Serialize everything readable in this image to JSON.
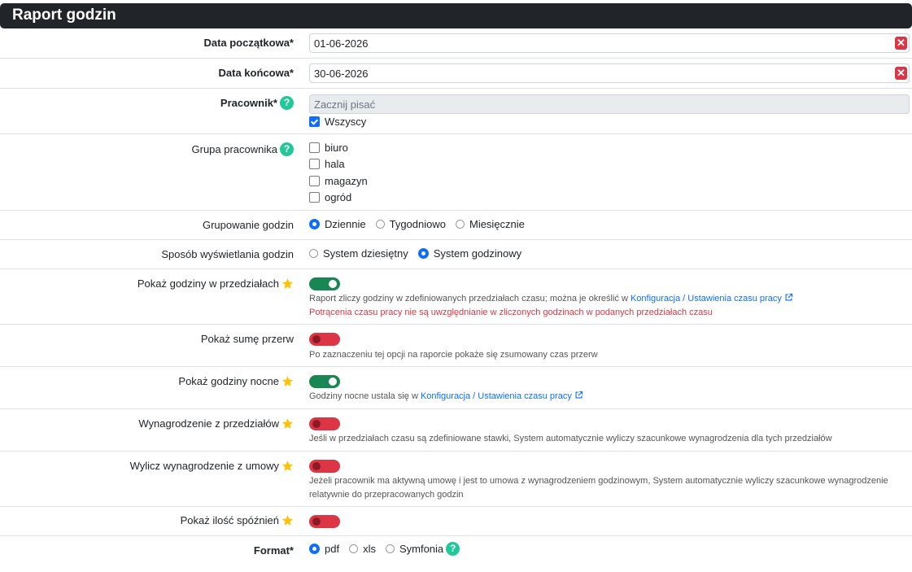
{
  "header": {
    "title": "Raport godzin"
  },
  "start_date": {
    "label": "Data początkowa*",
    "value": "01-06-2026"
  },
  "end_date": {
    "label": "Data końcowa*",
    "value": "30-06-2026"
  },
  "employee": {
    "label": "Pracownik*",
    "placeholder": "Zacznij pisać",
    "all_label": "Wszyscy",
    "all_checked": true
  },
  "group": {
    "label": "Grupa pracownika",
    "options": [
      "biuro",
      "hala",
      "magazyn",
      "ogród"
    ]
  },
  "grouping": {
    "label": "Grupowanie godzin",
    "options": [
      "Dziennie",
      "Tygodniowo",
      "Miesięcznie"
    ],
    "selected": "Dziennie"
  },
  "display": {
    "label": "Sposób wyświetlania godzin",
    "options": [
      "System dziesiętny",
      "System godzinowy"
    ],
    "selected": "System godzinowy"
  },
  "ranges": {
    "label": "Pokaż godziny w przedziałach",
    "enabled": true,
    "help_prefix": "Raport zliczy godziny w zdefiniowanych przedziałach czasu; można je określić w ",
    "help_link": "Konfiguracja / Ustawienia czasu pracy",
    "warning": "Potrącenia czasu pracy nie są uwzględnianie w zliczonych godzinach w podanych przedziałach czasu"
  },
  "breaks": {
    "label": "Pokaż sumę przerw",
    "enabled": false,
    "help": "Po zaznaczeniu tej opcji na raporcie pokaże się zsumowany czas przerw"
  },
  "night": {
    "label": "Pokaż godziny nocne",
    "enabled": true,
    "help_prefix": "Godziny nocne ustala się w ",
    "help_link": "Konfiguracja / Ustawienia czasu pracy"
  },
  "pay_ranges": {
    "label": "Wynagrodzenie z przedziałów",
    "enabled": false,
    "help": "Jeśli w przedziałach czasu są zdefiniowane stawki, System automatycznie wyliczy szacunkowe wynagrodzenia dla tych przedziałów"
  },
  "pay_contract": {
    "label": "Wylicz wynagrodzenie z umowy",
    "enabled": false,
    "help_line1": "Jeżeli pracownik ma aktywną umowę i jest to umowa z wynagrodzeniem godzinowym, System automatycznie wyliczy szacunkowe wynagrodzenie",
    "help_line2": "relatywnie do przepracowanych godzin"
  },
  "late": {
    "label": "Pokaż ilość spóźnień",
    "enabled": false
  },
  "format": {
    "label": "Format*",
    "options": [
      "pdf",
      "xls",
      "Symfonia"
    ],
    "selected": "pdf"
  },
  "colors": {
    "toggle_on": "#198754",
    "toggle_off": "#dc3545",
    "accent": "#0d6efd",
    "help_icon": "#20c997",
    "star": "#ffc107"
  }
}
